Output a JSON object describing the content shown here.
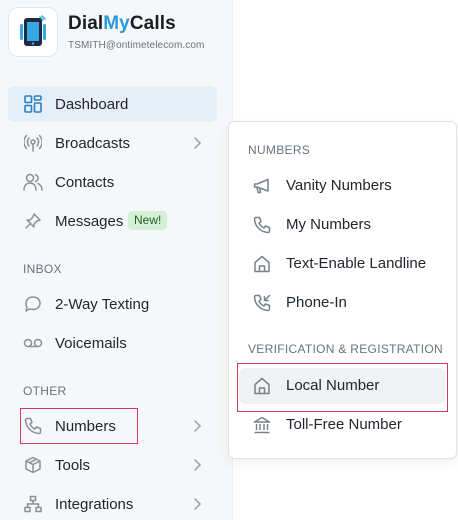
{
  "brand": {
    "name_part1": "Dial",
    "name_part2": "My",
    "name_part3": "Calls",
    "email": "TSMITH@ontimetelecom.com",
    "accent_color": "#2a9bd9"
  },
  "sidebar": {
    "items": [
      {
        "label": "Dashboard",
        "icon": "dashboard-grid-icon",
        "active": true
      },
      {
        "label": "Broadcasts",
        "icon": "broadcast-icon",
        "has_submenu": true
      },
      {
        "label": "Contacts",
        "icon": "contacts-icon"
      },
      {
        "label": "Messages",
        "icon": "pin-icon",
        "badge": "New!"
      },
      {
        "label": "2-Way Texting",
        "icon": "chat-bubble-icon"
      },
      {
        "label": "Voicemails",
        "icon": "voicemail-icon"
      },
      {
        "label": "Numbers",
        "icon": "phone-icon",
        "has_submenu": true,
        "highlighted": true
      },
      {
        "label": "Tools",
        "icon": "tools-box-icon",
        "has_submenu": true
      },
      {
        "label": "Integrations",
        "icon": "integrations-icon",
        "has_submenu": true
      }
    ],
    "sections": {
      "inbox": "INBOX",
      "other": "OTHER"
    }
  },
  "numbers_menu": {
    "section_numbers": "NUMBERS",
    "section_verification": "VERIFICATION & REGISTRATION",
    "items": [
      {
        "label": "Vanity Numbers",
        "icon": "megaphone-icon"
      },
      {
        "label": "My Numbers",
        "icon": "phone-icon"
      },
      {
        "label": "Text-Enable Landline",
        "icon": "home-icon"
      },
      {
        "label": "Phone-In",
        "icon": "phone-incoming-icon"
      },
      {
        "label": "Local Number",
        "icon": "home-icon",
        "highlighted": true
      },
      {
        "label": "Toll-Free Number",
        "icon": "bank-icon"
      }
    ]
  },
  "colors": {
    "highlight_border": "#d33a5c",
    "active_nav_bg": "#e6eff7",
    "badge_bg": "#d6f0d8"
  }
}
